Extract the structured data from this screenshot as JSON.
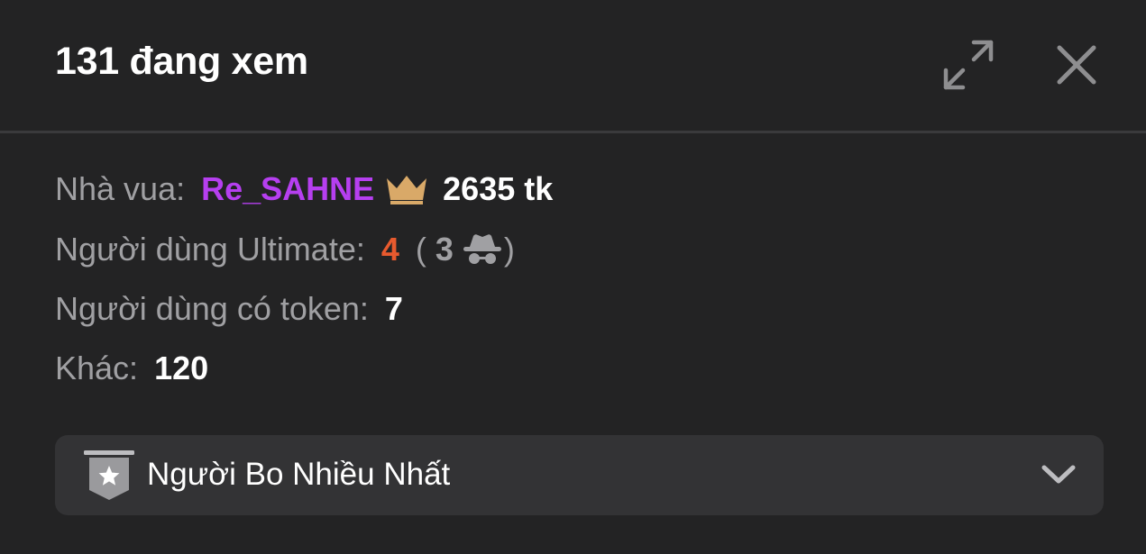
{
  "header": {
    "title": "131 đang xem",
    "expand_icon": "expand-arrows-icon",
    "close_icon": "close-icon"
  },
  "stats": {
    "king": {
      "label": "Nhà vua:",
      "name": "Re_SAHNE",
      "name_color": "#b63ff0",
      "icon": "crown-icon",
      "tokens": "2635 tk"
    },
    "ultimate": {
      "label": "Người dùng Ultimate:",
      "count": "4",
      "count_color": "#e85a2e",
      "open_paren": "(",
      "anonymous_count": "3",
      "anonymous_icon": "incognito-spy-icon",
      "close_paren": ")"
    },
    "token_users": {
      "label": "Người dùng có token:",
      "count": "7"
    },
    "other": {
      "label": "Khác:",
      "count": "120"
    }
  },
  "top_donors": {
    "label": "Người Bo Nhiều Nhất",
    "icon": "star-badge-icon",
    "toggle_icon": "chevron-down-icon"
  },
  "colors": {
    "background": "#232324",
    "panel": "#333335",
    "muted_text": "#a0a0a3",
    "crown": "#d9a968"
  }
}
